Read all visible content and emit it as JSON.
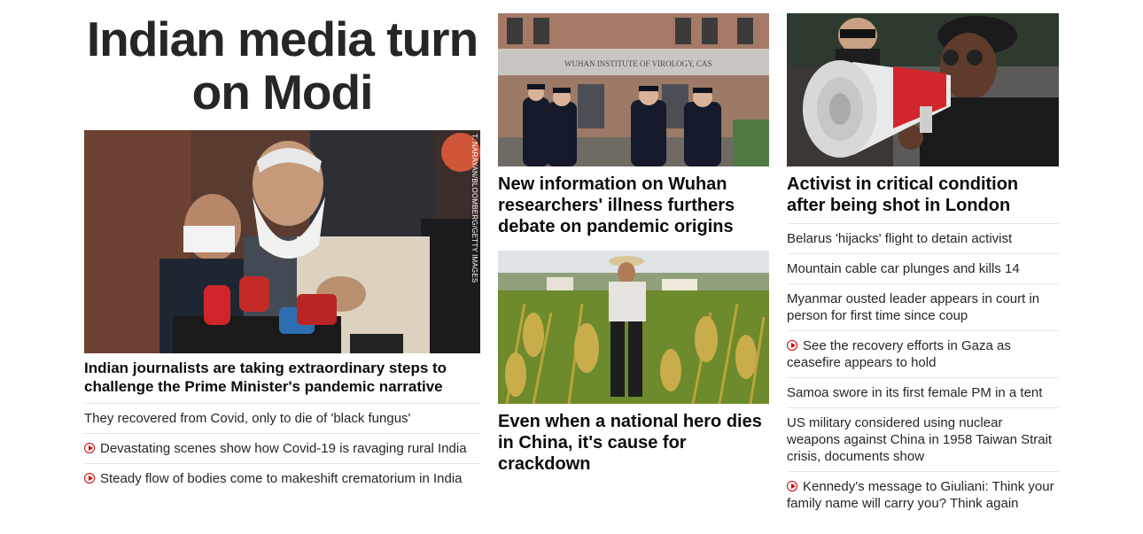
{
  "col1": {
    "big_headline": "Indian media turn on Modi",
    "image_credit": "T. NARAYAN/BLOOMBERG/GETTY IMAGES",
    "lead_title": "Indian journalists are taking extraordinary steps to challenge the Prime Minister's pandemic narrative",
    "items": [
      {
        "text": "They recovered from Covid, only to die of 'black fungus'",
        "video": false
      },
      {
        "text": "Devastating scenes show how Covid-19 is ravaging rural India",
        "video": true
      },
      {
        "text": "Steady flow of bodies come to makeshift crematorium in India",
        "video": true
      }
    ]
  },
  "col2": {
    "wuhan_sign": "WUHAN INSTITUTE OF VIROLOGY, CAS",
    "story1_title": "New information on Wuhan researchers' illness furthers debate on pandemic origins",
    "story2_title": "Even when a national hero dies in China, it's cause for crackdown"
  },
  "col3": {
    "lead_title": "Activist in critical condition after being shot in London",
    "items": [
      {
        "text": "Belarus 'hijacks' flight to detain activist",
        "video": false
      },
      {
        "text": "Mountain cable car plunges and kills 14",
        "video": false
      },
      {
        "text": "Myanmar ousted leader appears in court in person for first time since coup",
        "video": false
      },
      {
        "text": "See the recovery efforts in Gaza as ceasefire appears to hold",
        "video": true
      },
      {
        "text": "Samoa swore in its first female PM in a tent",
        "video": false
      },
      {
        "text": "US military considered using nuclear weapons against China in 1958 Taiwan Strait crisis, documents show",
        "video": false
      },
      {
        "text": "Kennedy's message to Giuliani: Think your family name will carry you? Think again",
        "video": true
      }
    ]
  },
  "colors": {
    "accent": "#cc0000",
    "text": "#0c0c0c",
    "divider": "#e6e6e6"
  },
  "icons": {
    "video": "play-icon"
  }
}
